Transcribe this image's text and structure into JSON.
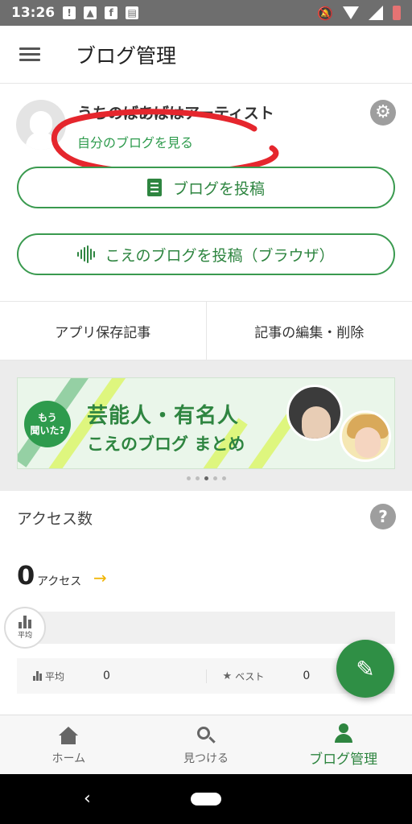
{
  "status_bar": {
    "time": "13:26"
  },
  "app_bar": {
    "title": "ブログ管理"
  },
  "profile": {
    "name": "うちのばあばはアーティスト",
    "view_blog_link": "自分のブログを見る",
    "post_blog_button": "ブログを投稿",
    "post_voice_button": "こえのブログを投稿（ブラウザ）"
  },
  "shortcuts": {
    "saved_articles": "アプリ保存記事",
    "edit_delete": "記事の編集・削除"
  },
  "banner": {
    "badge_line1": "もう",
    "badge_line2": "聞いた?",
    "title_line1": "芸能人・有名人",
    "title_line2": "こえのブログ まとめ",
    "page_count": 5,
    "active_page": 3
  },
  "access": {
    "title": "アクセス数",
    "count": "0",
    "unit": "アクセス",
    "avg_marker_label": "平均",
    "avg_label": "平均",
    "avg_value": "0",
    "best_label": "ベスト",
    "best_value": "0"
  },
  "bottom_nav": {
    "home": "ホーム",
    "discover": "見つける",
    "manage": "ブログ管理"
  },
  "colors": {
    "brand_green": "#2e8540",
    "annotation_red": "#e5262d"
  }
}
